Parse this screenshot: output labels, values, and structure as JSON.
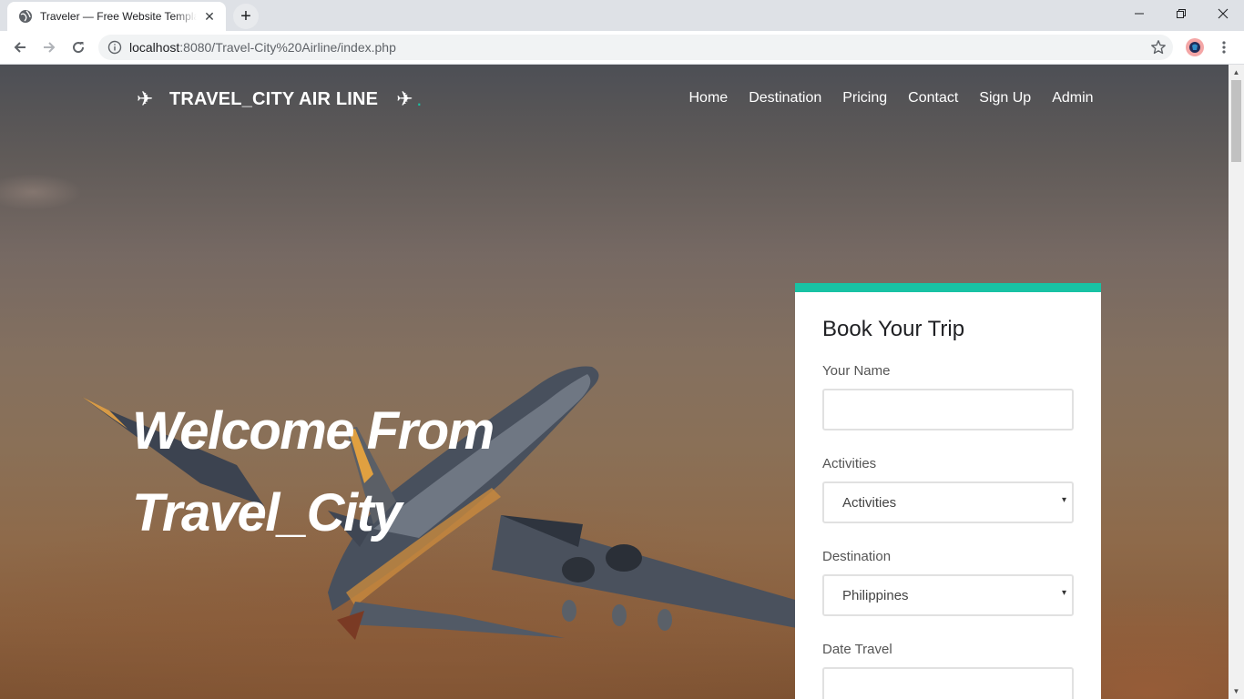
{
  "browser": {
    "tab_title": "Traveler — Free Website Template",
    "tab_close": "✕",
    "new_tab": "+",
    "url_host": "localhost",
    "url_rest": ":8080/Travel-City%20Airline/index.php",
    "window_controls": {
      "minimize": "—",
      "maximize": "❐",
      "close": "✕"
    }
  },
  "site": {
    "brand": "TRAVEL_CITY AIR LINE",
    "brand_icon": "✈",
    "brand_dot": ".",
    "nav": [
      "Home",
      "Destination",
      "Pricing",
      "Contact",
      "Sign Up",
      "Admin"
    ],
    "hero_line1": "Welcome From",
    "hero_line2": "Travel_City"
  },
  "booking": {
    "title": "Book Your Trip",
    "name_label": "Your Name",
    "name_value": "",
    "activities_label": "Activities",
    "activities_value": "Activities",
    "destination_label": "Destination",
    "destination_value": "Philippines",
    "date_label": "Date Travel",
    "date_value": ""
  },
  "colors": {
    "accent": "#18c2a4",
    "tab_bg": "#dee1e6",
    "omnibox_bg": "#f1f3f4"
  },
  "icons": {
    "favicon": "globe-icon",
    "back": "arrow-left-icon",
    "forward": "arrow-right-icon",
    "reload": "reload-icon",
    "info": "info-icon",
    "bookmark": "star-icon",
    "profile": "avatar-icon",
    "menu": "kebab-menu-icon",
    "select_arrow": "▾"
  }
}
